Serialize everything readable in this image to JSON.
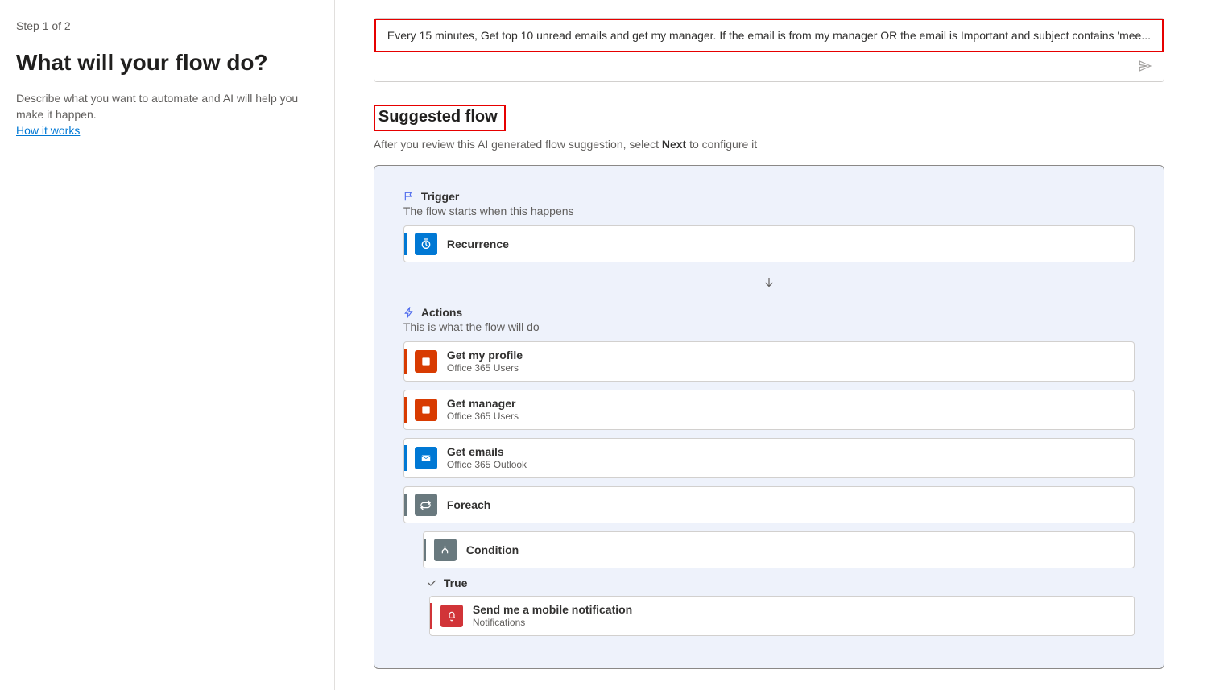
{
  "left": {
    "step": "Step 1 of 2",
    "headline": "What will your flow do?",
    "description": "Describe what you want to automate and AI will help you make it happen.",
    "how_link": "How it works"
  },
  "prompt": {
    "text": "Every 15 minutes, Get top 10 unread emails and get my manager. If the email is from my manager OR the email is Important and subject contains 'mee..."
  },
  "suggested": {
    "heading": "Suggested flow",
    "sub_before": "After you review this AI generated flow suggestion, select ",
    "sub_bold": "Next",
    "sub_after": " to configure it"
  },
  "trigger_section": {
    "label": "Trigger",
    "sub": "The flow starts when this happens"
  },
  "actions_section": {
    "label": "Actions",
    "sub": "This is what the flow will do"
  },
  "cards": {
    "recurrence": {
      "title": "Recurrence"
    },
    "get_profile": {
      "title": "Get my profile",
      "subtitle": "Office 365 Users"
    },
    "get_manager": {
      "title": "Get manager",
      "subtitle": "Office 365 Users"
    },
    "get_emails": {
      "title": "Get emails",
      "subtitle": "Office 365 Outlook"
    },
    "foreach": {
      "title": "Foreach"
    },
    "condition": {
      "title": "Condition"
    },
    "true_label": "True",
    "notification": {
      "title": "Send me a mobile notification",
      "subtitle": "Notifications"
    }
  },
  "colors": {
    "blue": "#0078d4",
    "orange": "#d83b01",
    "gray": "#69797e",
    "red": "#d13438",
    "highlight": "#e60000"
  }
}
